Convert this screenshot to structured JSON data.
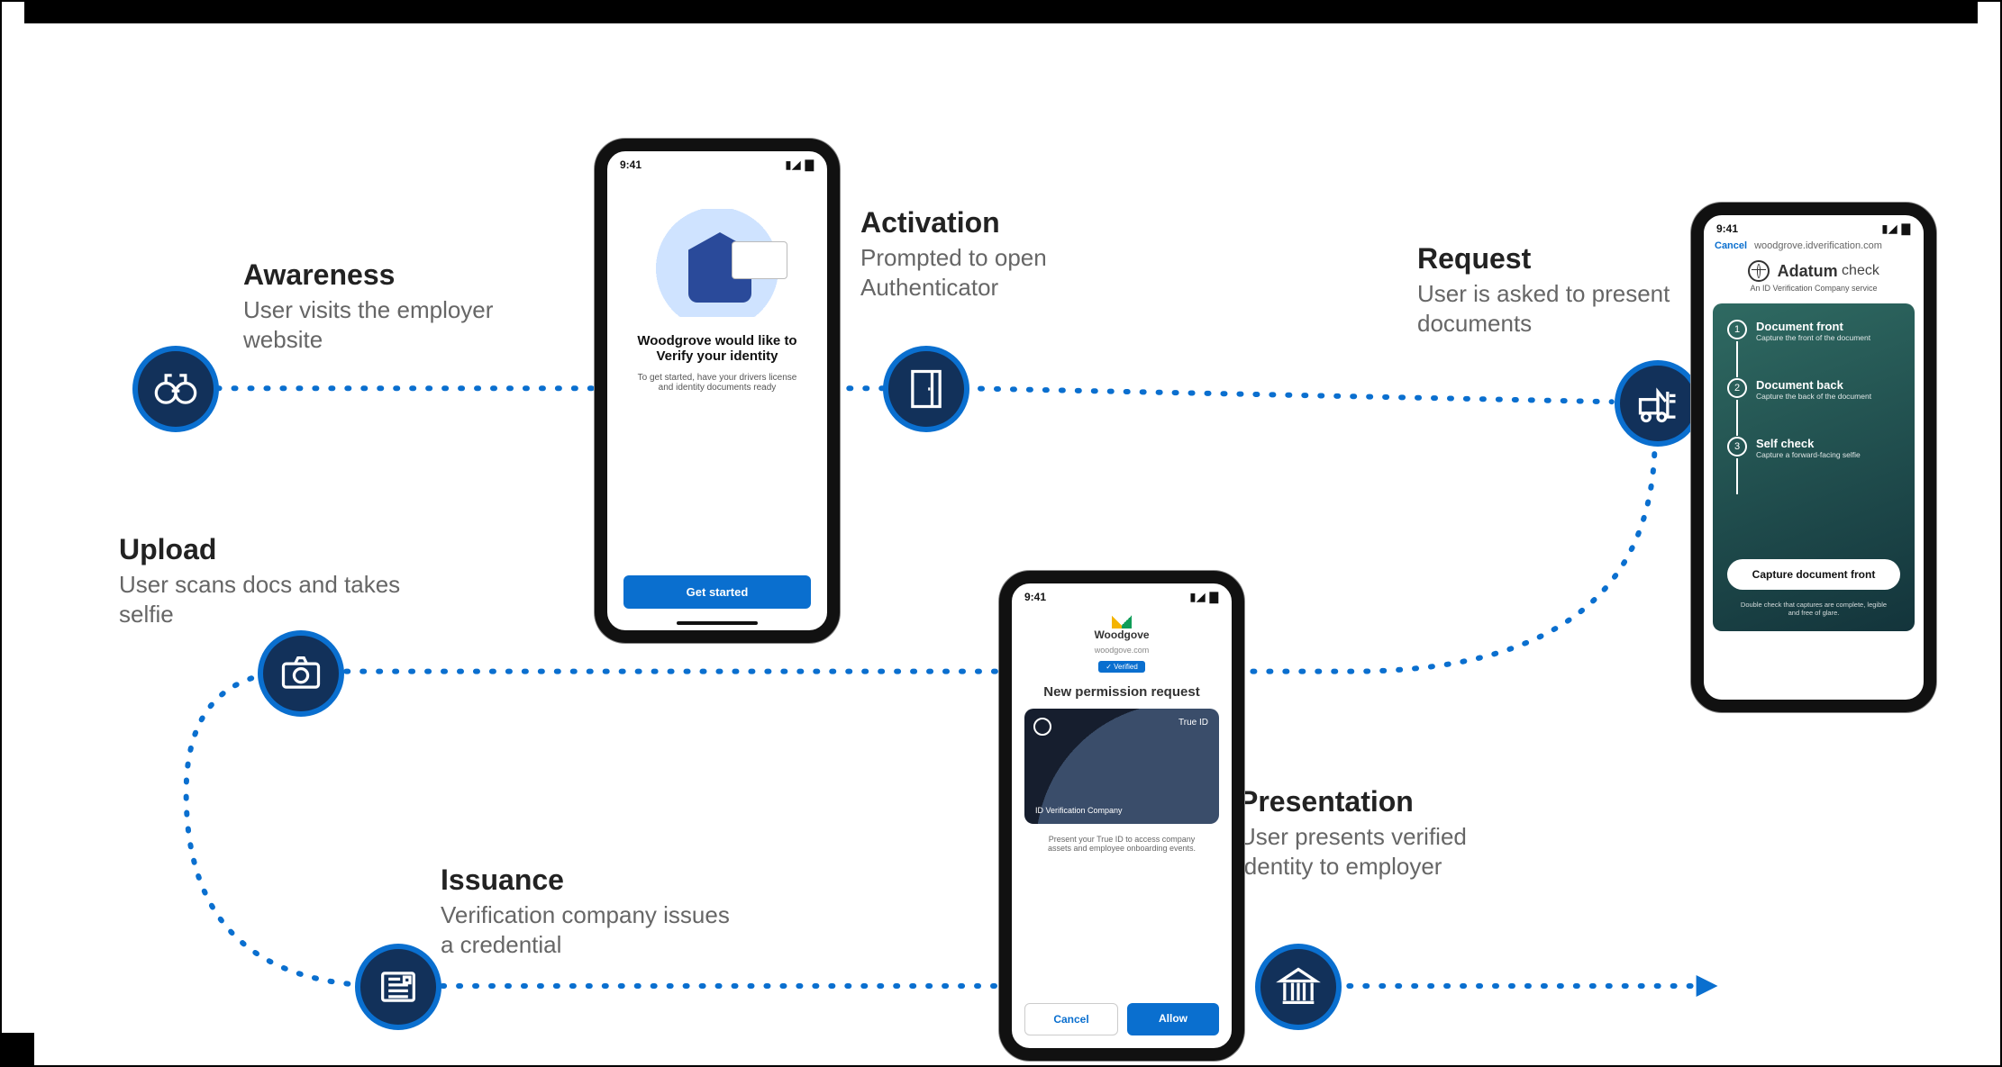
{
  "steps": {
    "awareness": {
      "title": "Awareness",
      "desc": "User visits the employer website"
    },
    "activation": {
      "title": "Activation",
      "desc": "Prompted to open Authenticator"
    },
    "request": {
      "title": "Request",
      "desc": "User is asked to present documents"
    },
    "upload": {
      "title": "Upload",
      "desc": "User scans docs and takes selfie"
    },
    "issuance": {
      "title": "Issuance",
      "desc": "Verification company issues a credential"
    },
    "presentation": {
      "title": "Presentation",
      "desc": "User presents verified identity to employer"
    }
  },
  "phones": {
    "status_time": "9:41",
    "status_icons": "▮◢ ▇",
    "awareness": {
      "headline": "Woodgrove would like to Verify your identity",
      "instruction": "To get started, have your drivers license and identity documents ready",
      "cta": "Get started"
    },
    "request": {
      "cancel": "Cancel",
      "url": "woodgrove.idverification.com",
      "brand_bold": "Adatum",
      "brand_rest": "check",
      "tagline": "An ID Verification Company service",
      "steps": {
        "s1_title": "Document front",
        "s1_sub": "Capture the front of the document",
        "s2_title": "Document back",
        "s2_sub": "Capture the back of the document",
        "s3_title": "Self check",
        "s3_sub": "Capture a forward-facing selfie"
      },
      "cta": "Capture document front",
      "fineprint": "Double check that captures are complete, legible and free of glare."
    },
    "presentation": {
      "company": "Woodgove",
      "domain": "woodgove.com",
      "badge": "✓ Verified",
      "title": "New permission request",
      "card_type": "True ID",
      "card_issuer": "ID Verification Company",
      "description": "Present your True ID to access company assets and employee onboarding events.",
      "cancel": "Cancel",
      "allow": "Allow"
    }
  }
}
